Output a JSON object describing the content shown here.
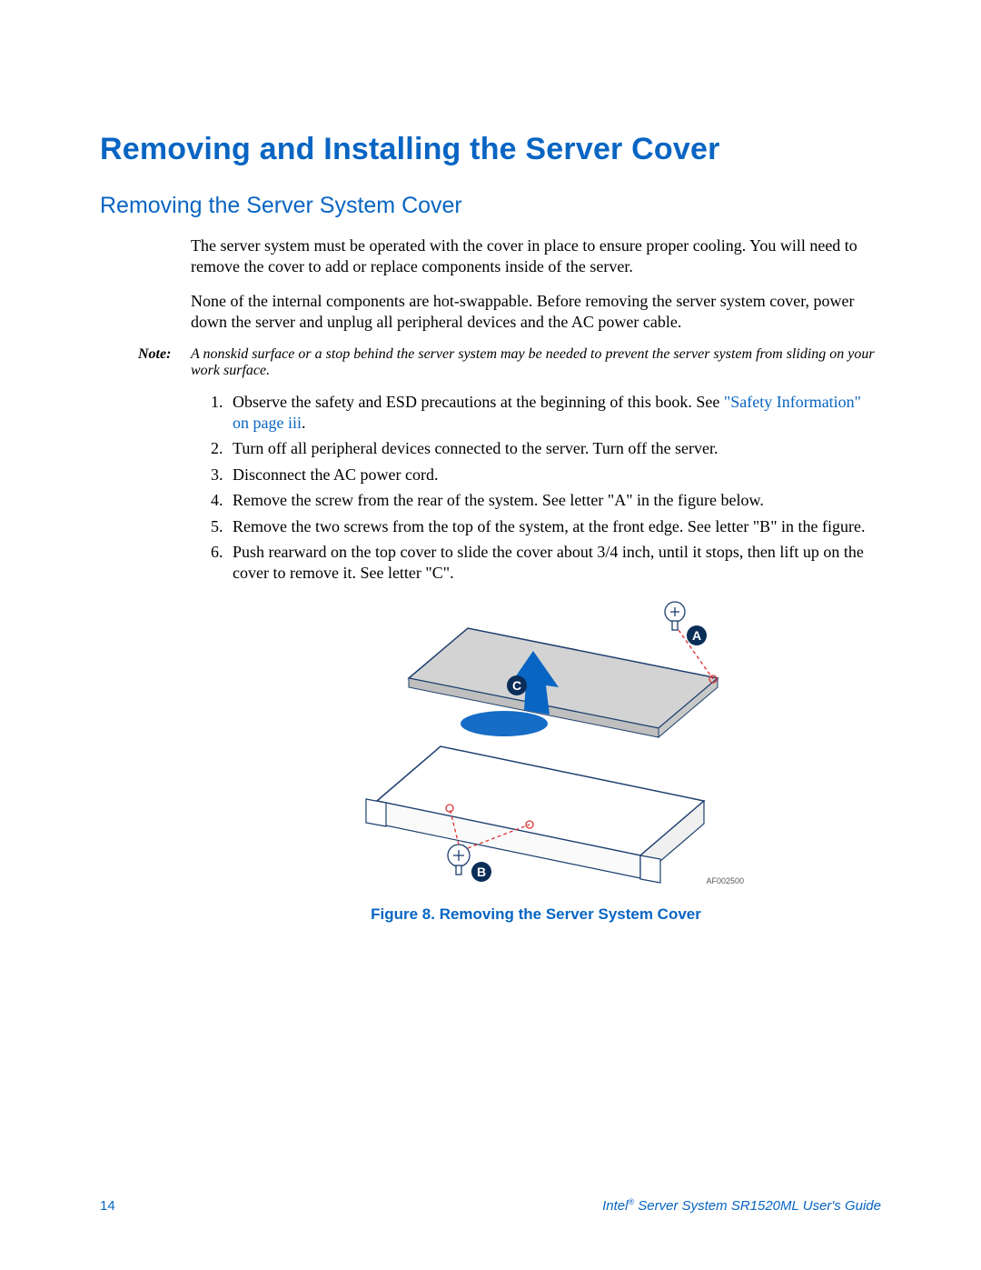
{
  "title": "Removing and Installing the Server Cover",
  "subtitle": "Removing the Server System Cover",
  "paragraphs": {
    "p1": "The server system must be operated with the cover in place to ensure proper cooling. You will need to remove the cover to add or replace components inside of the server.",
    "p2": "None of the internal components are hot-swappable. Before removing the server system cover, power down the server and unplug all peripheral devices and the AC power cable."
  },
  "note": {
    "label": "Note:",
    "text": "A nonskid surface or a stop behind the server system may be needed to prevent the server system from sliding on your work surface."
  },
  "steps": {
    "s1_pre": "Observe the safety and ESD precautions at the beginning of this book. See ",
    "s1_link": "\"Safety Information\" on page iii",
    "s1_post": ".",
    "s2": "Turn off all peripheral devices connected to the server. Turn off the server.",
    "s3": "Disconnect the AC power cord.",
    "s4": "Remove the screw from the rear of the system. See letter \"A\" in the figure below.",
    "s5": "Remove the two screws from the top of the system, at the front edge. See letter \"B\" in the figure.",
    "s6": "Push rearward on the top cover to slide the cover about 3/4 inch, until it stops, then lift up on the cover to remove it. See letter \"C\"."
  },
  "figure": {
    "caption": "Figure 8. Removing the Server System Cover",
    "code": "AF002500",
    "labels": {
      "a": "A",
      "b": "B",
      "c": "C"
    }
  },
  "footer": {
    "page": "14",
    "brand_prefix": "Intel",
    "brand_suffix": " Server System SR1520ML User's Guide"
  }
}
